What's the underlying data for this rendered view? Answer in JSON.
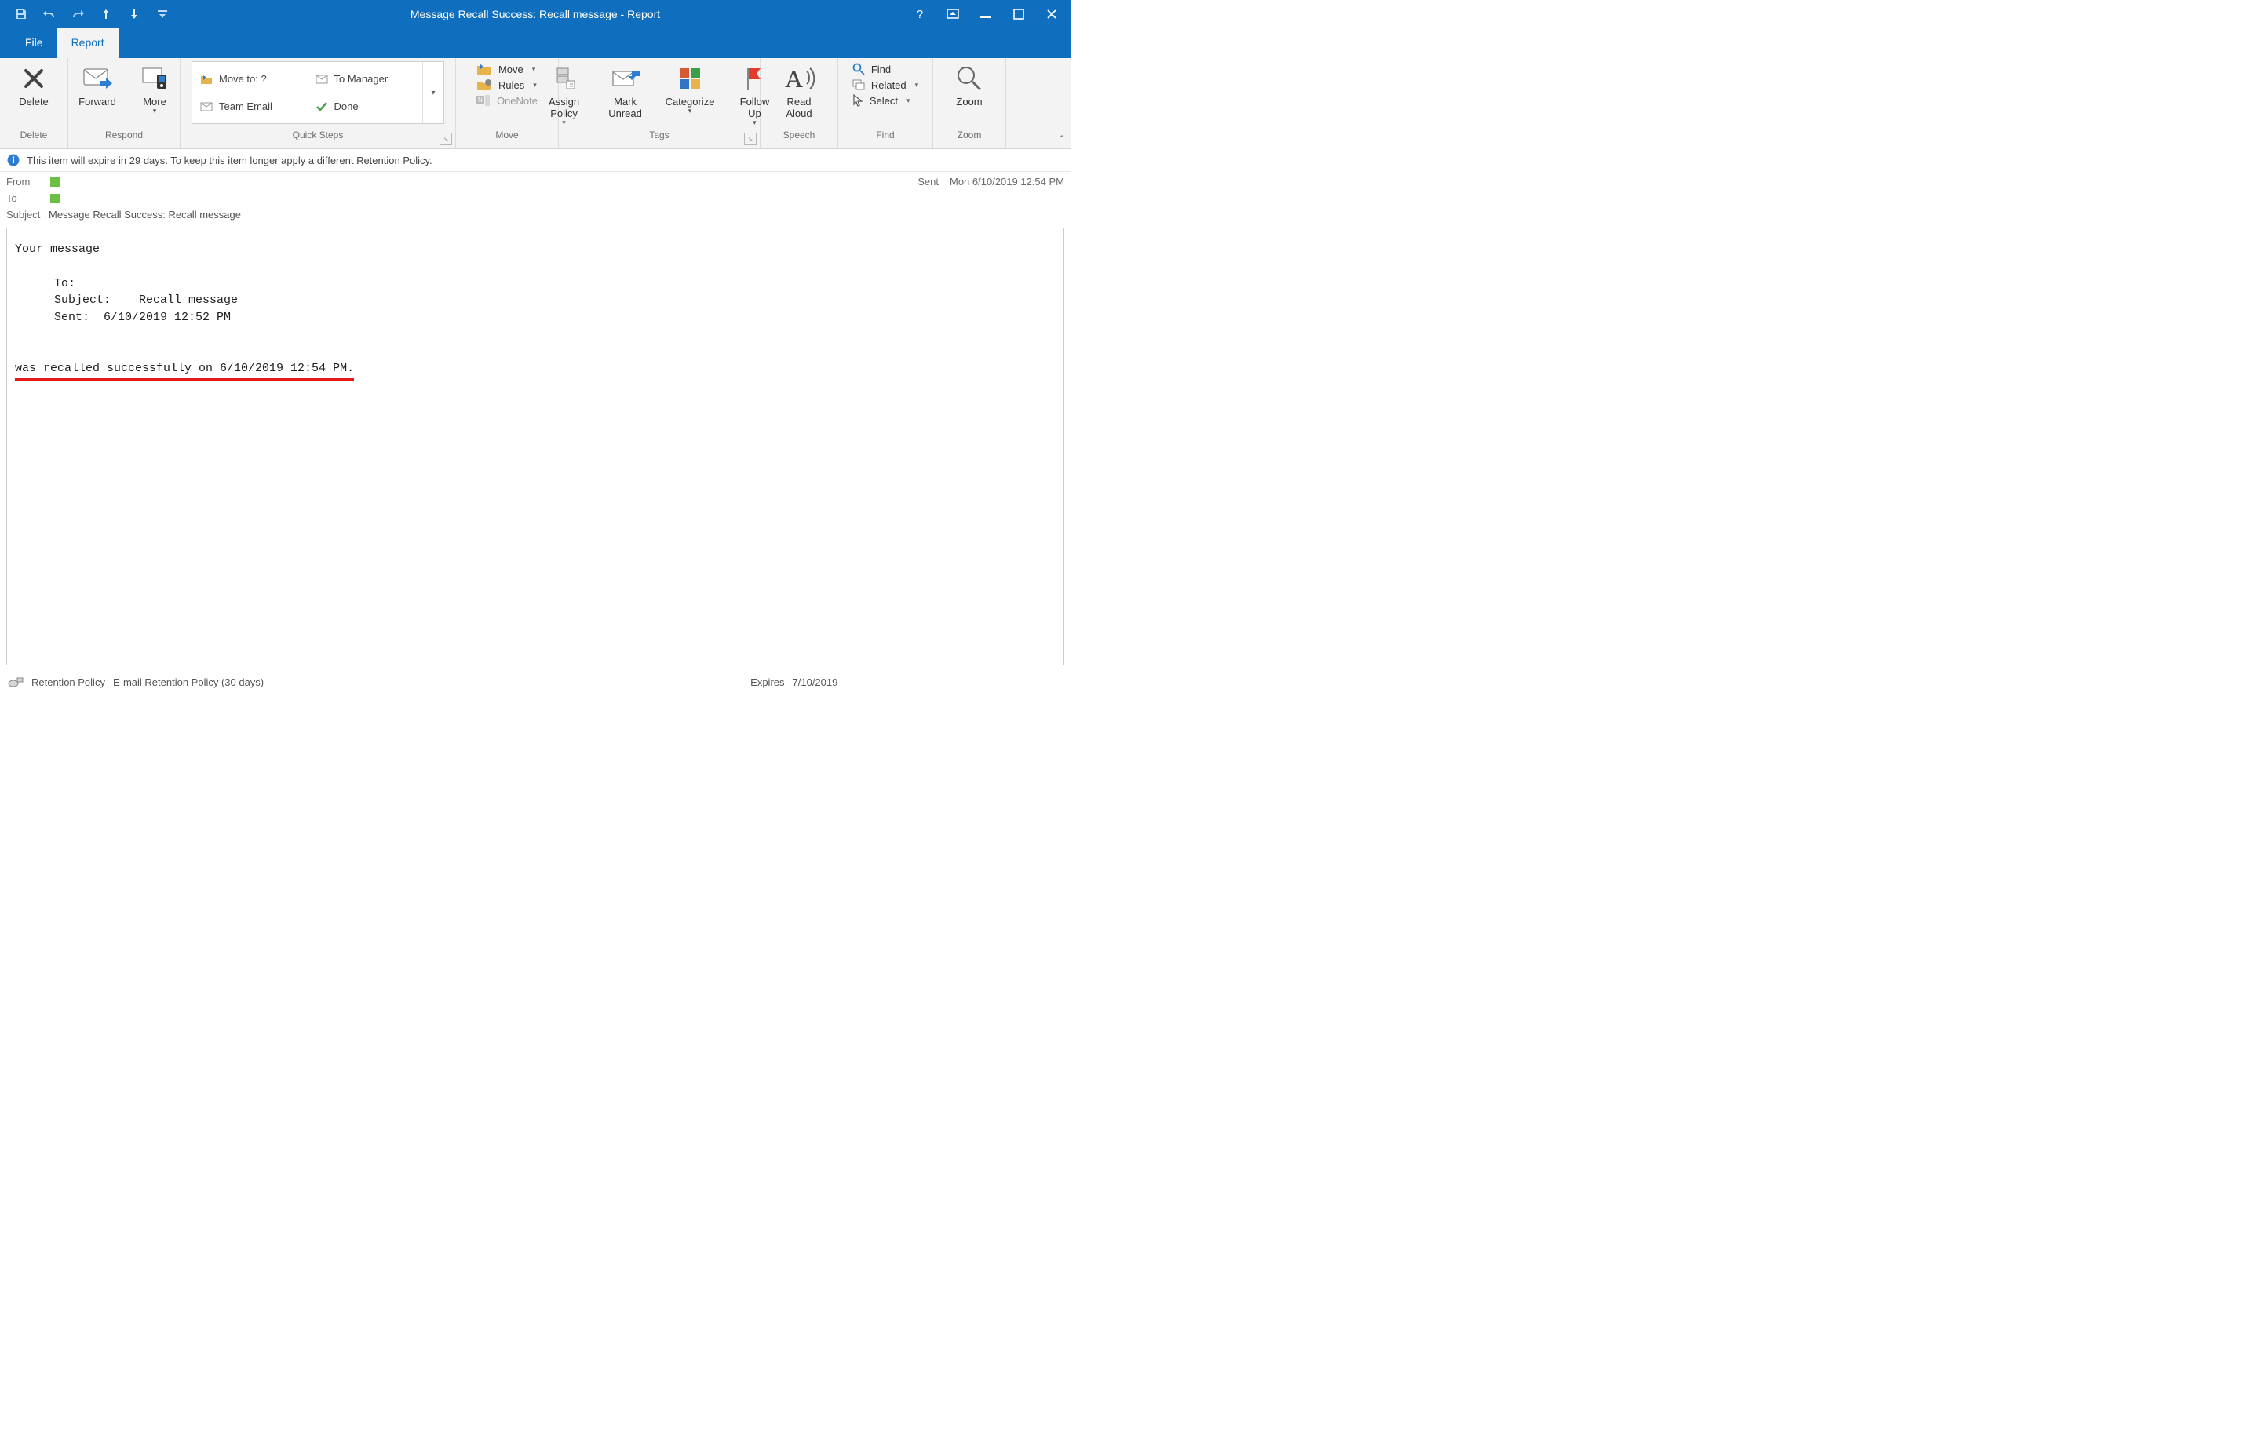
{
  "window": {
    "title": "Message Recall Success: Recall message  -  Report"
  },
  "tabs": {
    "file": "File",
    "report": "Report"
  },
  "groups": {
    "delete": {
      "label": "Delete",
      "delete_btn": "Delete"
    },
    "respond": {
      "label": "Respond",
      "forward": "Forward",
      "more": "More"
    },
    "quicksteps": {
      "label": "Quick Steps",
      "move_to": "Move to: ?",
      "team_email": "Team Email",
      "to_manager": "To Manager",
      "done": "Done"
    },
    "move": {
      "label": "Move",
      "move_btn": "Move",
      "rules_btn": "Rules",
      "onenote_btn": "OneNote"
    },
    "tags": {
      "label": "Tags",
      "assign_policy": "Assign\nPolicy",
      "mark_unread": "Mark\nUnread",
      "categorize": "Categorize",
      "follow_up": "Follow\nUp"
    },
    "speech": {
      "label": "Speech",
      "read_aloud": "Read\nAloud"
    },
    "find": {
      "label": "Find",
      "find_btn": "Find",
      "related_btn": "Related",
      "select_btn": "Select"
    },
    "zoom": {
      "label": "Zoom",
      "zoom_btn": "Zoom"
    }
  },
  "info_bar": "This item will expire in 29 days. To keep this item longer apply a different Retention Policy.",
  "header": {
    "from_label": "From",
    "to_label": "To",
    "subject_label": "Subject",
    "subject_value": "Message Recall Success: Recall message",
    "sent_label": "Sent",
    "sent_value": "Mon 6/10/2019 12:54 PM"
  },
  "body": {
    "line1": "Your message",
    "to_lbl": "To:",
    "subj_lbl": "Subject:",
    "subj_val": "Recall message",
    "sent_lbl": "Sent:",
    "sent_val": "6/10/2019 12:52 PM",
    "result": "was recalled successfully on 6/10/2019 12:54 PM."
  },
  "status": {
    "retention_label": "Retention Policy",
    "retention_value": "E-mail Retention Policy (30 days)",
    "expires_label": "Expires",
    "expires_value": "7/10/2019"
  }
}
